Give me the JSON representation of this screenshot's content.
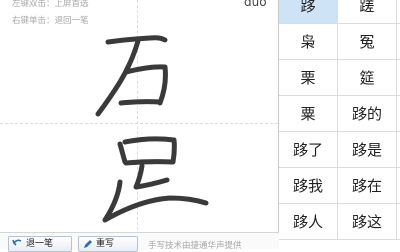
{
  "canvas": {
    "hint_double_click": "左键双击：上屏首选",
    "hint_right_click": "右键单击：退回一笔",
    "pinyin": "duo",
    "footnote": "手写技术由捷通华声提供"
  },
  "toolbar": {
    "undo_label": "退一笔",
    "rewrite_label": "重写"
  },
  "candidates": [
    [
      "跢",
      "蹉"
    ],
    [
      "枭",
      "冤"
    ],
    [
      "栗",
      "筵"
    ],
    [
      "粟",
      "跢的"
    ],
    [
      "跢了",
      "跢是"
    ],
    [
      "跢我",
      "跢在"
    ],
    [
      "跢人",
      "跢这"
    ]
  ],
  "selected_index": 0,
  "colors": {
    "selected_bg": "#cfe3f7",
    "ink": "#3a3a3a"
  }
}
